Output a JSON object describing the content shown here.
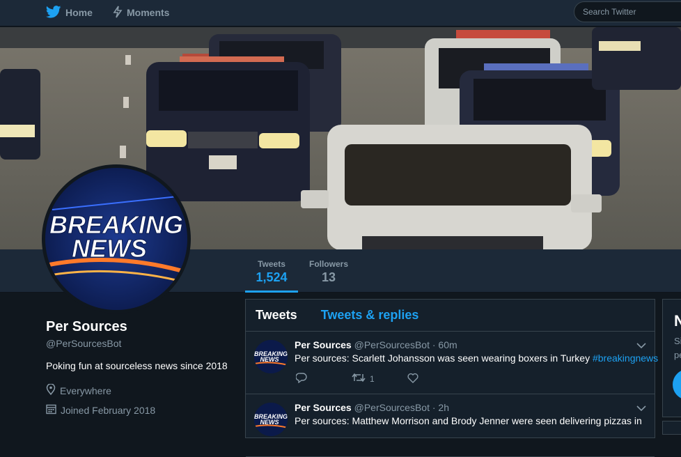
{
  "nav": {
    "home_label": "Home",
    "moments_label": "Moments",
    "search_placeholder": "Search Twitter"
  },
  "avatar": {
    "line1": "BREAKING",
    "line2": "NEWS"
  },
  "stats": [
    {
      "label": "Tweets",
      "value": "1,524"
    },
    {
      "label": "Followers",
      "value": "13"
    }
  ],
  "profile": {
    "name": "Per Sources",
    "handle": "@PerSourcesBot",
    "bio": "Poking fun at sourceless news since 2018",
    "location": "Everywhere",
    "joined": "Joined February 2018"
  },
  "tabs": {
    "tweets": "Tweets",
    "replies": "Tweets & replies"
  },
  "tweets": [
    {
      "name": "Per Sources",
      "handle": "@PerSourcesBot · 60m",
      "text": "Per sources: Scarlett Johansson was seen wearing boxers in Turkey ",
      "hashtag": "#breakingnews",
      "retweets": "1"
    },
    {
      "name": "Per Sources",
      "handle": "@PerSourcesBot · 2h",
      "text": "Per sources: Matthew Morrison and Brody Jenner were seen delivering pizzas in",
      "hashtag": "",
      "retweets": ""
    }
  ],
  "right_card": {
    "letter": "N",
    "s1": "Si",
    "s2": "pe"
  },
  "colors": {
    "accent": "#1da1f2",
    "background": "#10171e",
    "panel": "#15202b",
    "bar": "#1c2938",
    "muted": "#8899a6"
  }
}
